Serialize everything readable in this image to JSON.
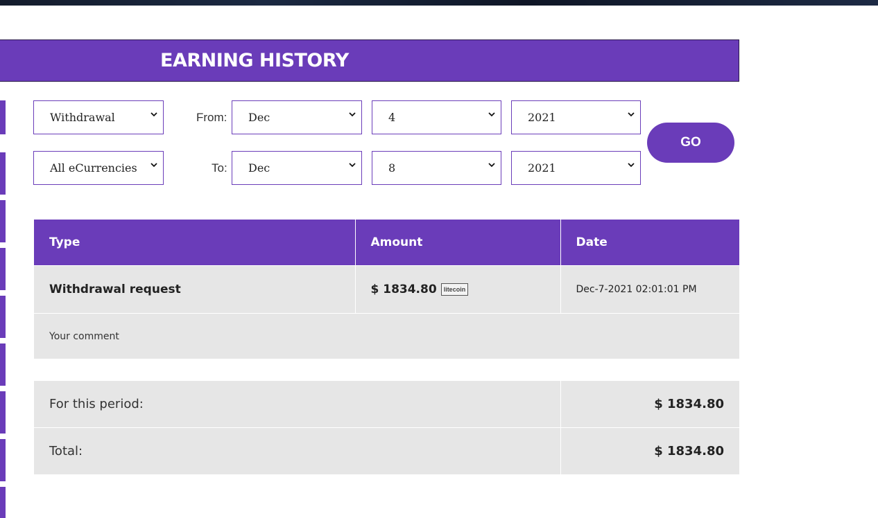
{
  "header": {
    "title": "EARNING HISTORY"
  },
  "filters": {
    "type_select": "Withdrawal",
    "currency_select": "All eCurrencies",
    "from_label": "From:",
    "to_label": "To:",
    "from": {
      "month": "Dec",
      "day": "4",
      "year": "2021"
    },
    "to": {
      "month": "Dec",
      "day": "8",
      "year": "2021"
    },
    "go_label": "GO"
  },
  "table": {
    "headers": [
      "Type",
      "Amount",
      "Date"
    ],
    "row": {
      "type": "Withdrawal request",
      "amount": "$ 1834.80",
      "coin_badge": "litecoin",
      "date": "Dec-7-2021 02:01:01 PM"
    },
    "comment": "Your comment"
  },
  "summary": {
    "period_label": "For this period:",
    "period_amount": "$ 1834.80",
    "total_label": "Total:",
    "total_amount": "$ 1834.80"
  },
  "colors": {
    "accent": "#6a3cb9",
    "row_bg": "#e6e6e6"
  }
}
